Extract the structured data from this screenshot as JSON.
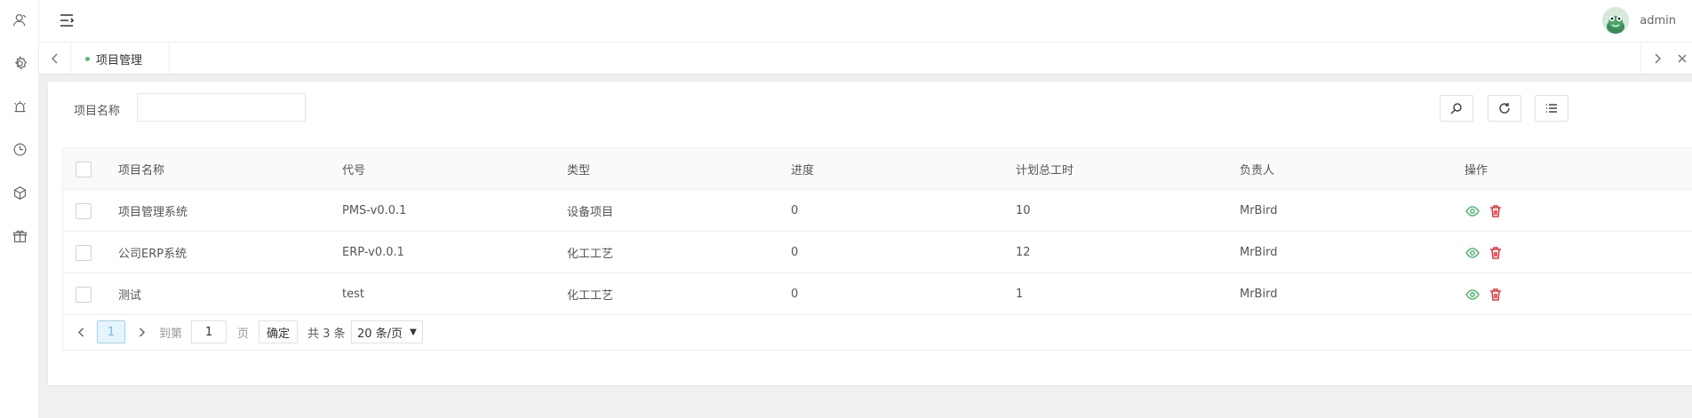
{
  "header": {
    "username": "admin"
  },
  "sidebar": {
    "icons": [
      "user-icon",
      "settings-icon",
      "alarm-icon",
      "clock-icon",
      "cube-icon",
      "gift-icon"
    ]
  },
  "tabs": [
    {
      "label": "项目管理",
      "active": true
    }
  ],
  "filter": {
    "label": "项目名称",
    "value": "",
    "placeholder": ""
  },
  "table": {
    "columns": [
      "项目名称",
      "代号",
      "类型",
      "进度",
      "计划总工时",
      "负责人",
      "操作"
    ],
    "rows": [
      {
        "name": "项目管理系统",
        "code": "PMS-v0.0.1",
        "type": "设备项目",
        "progress": "0",
        "hours": "10",
        "owner": "MrBird"
      },
      {
        "name": "公司ERP系统",
        "code": "ERP-v0.0.1",
        "type": "化工工艺",
        "progress": "0",
        "hours": "12",
        "owner": "MrBird"
      },
      {
        "name": "测试",
        "code": "test",
        "type": "化工工艺",
        "progress": "0",
        "hours": "1",
        "owner": "MrBird"
      }
    ]
  },
  "pager": {
    "current_page": "1",
    "goto_label": "到第",
    "goto_value": "1",
    "page_unit": "页",
    "confirm_label": "确定",
    "total_label": "共 3 条",
    "page_size_label": "20 条/页"
  },
  "colors": {
    "accent_green": "#5fb878",
    "danger_red": "#e0393e",
    "page_active_bg": "#e6f4fb"
  }
}
